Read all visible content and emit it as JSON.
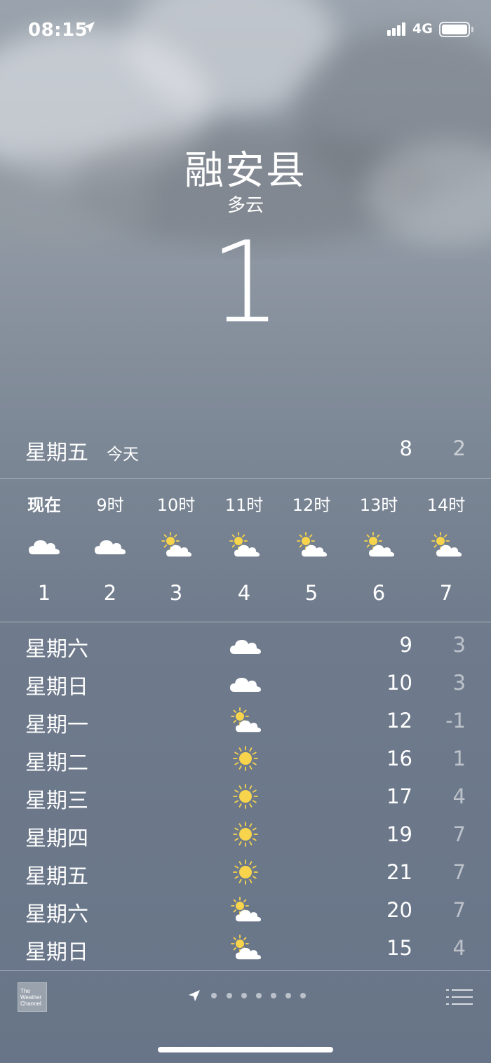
{
  "status_bar": {
    "time": "08:15",
    "network": "4G"
  },
  "header": {
    "city": "融安县",
    "condition": "多云",
    "current_temp": "1"
  },
  "today": {
    "day": "星期五",
    "label": "今天",
    "high": "8",
    "low": "2"
  },
  "hourly": [
    {
      "label": "现在",
      "icon": "cloud-icon",
      "temp": "1"
    },
    {
      "label": "9时",
      "icon": "cloud-icon",
      "temp": "2"
    },
    {
      "label": "10时",
      "icon": "partly-cloudy-icon",
      "temp": "3"
    },
    {
      "label": "11时",
      "icon": "partly-cloudy-icon",
      "temp": "4"
    },
    {
      "label": "12时",
      "icon": "partly-cloudy-icon",
      "temp": "5"
    },
    {
      "label": "13时",
      "icon": "partly-cloudy-icon",
      "temp": "6"
    },
    {
      "label": "14时",
      "icon": "partly-cloudy-icon",
      "temp": "7"
    }
  ],
  "daily": [
    {
      "day": "星期六",
      "icon": "cloud-icon",
      "high": "9",
      "low": "3"
    },
    {
      "day": "星期日",
      "icon": "cloud-icon",
      "high": "10",
      "low": "3"
    },
    {
      "day": "星期一",
      "icon": "partly-cloudy-icon",
      "high": "12",
      "low": "-1"
    },
    {
      "day": "星期二",
      "icon": "sun-icon",
      "high": "16",
      "low": "1"
    },
    {
      "day": "星期三",
      "icon": "sun-icon",
      "high": "17",
      "low": "4"
    },
    {
      "day": "星期四",
      "icon": "sun-icon",
      "high": "19",
      "low": "7"
    },
    {
      "day": "星期五",
      "icon": "sun-icon",
      "high": "21",
      "low": "7"
    },
    {
      "day": "星期六",
      "icon": "partly-cloudy-icon",
      "high": "20",
      "low": "7"
    },
    {
      "day": "星期日",
      "icon": "partly-cloudy-icon",
      "high": "15",
      "low": "4"
    }
  ],
  "footer": {
    "logo_lines": [
      "The",
      "Weather",
      "Channel"
    ],
    "page_count": 7,
    "icons": [
      "location-arrow-icon",
      "list-icon"
    ]
  },
  "colors": {
    "sun": "#f8d44c",
    "cloud": "#ffffff"
  }
}
